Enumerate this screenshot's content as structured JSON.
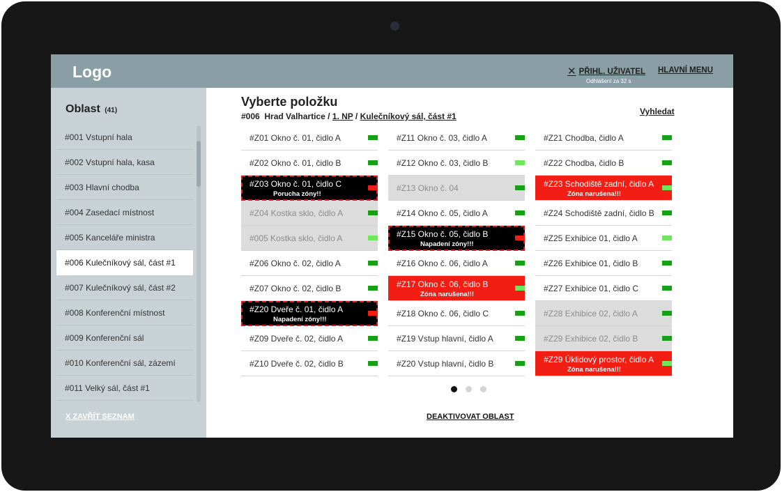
{
  "header": {
    "logo": "Logo",
    "logout_label": "PŘIHL. UŽIVATEL",
    "logout_timer": "Odhlášení za 32 s",
    "main_menu": "HLAVNÍ MENU"
  },
  "sidebar": {
    "title": "Oblast",
    "count": "(41)",
    "items": [
      {
        "label": "#001  Vstupní hala"
      },
      {
        "label": "#002  Vstupní hala, kasa"
      },
      {
        "label": "#003  Hlavní chodba"
      },
      {
        "label": "#004  Zasedací místnost"
      },
      {
        "label": "#005  Kanceláře ministra"
      },
      {
        "label": "#006  Kulečníkový sál, část #1"
      },
      {
        "label": "#007  Kulečníkový sál, část #2"
      },
      {
        "label": "#008  Konferenční místnost"
      },
      {
        "label": "#009  Konferenční sál"
      },
      {
        "label": "#010   Konferenční sál, zázemí"
      },
      {
        "label": "#011  Velký sál, část #1"
      }
    ],
    "active_index": 5,
    "close_label": "X ZAVŘÍT SEZNAM"
  },
  "main": {
    "title": "Vyberte položku",
    "breadcrumb": {
      "id": "#006",
      "building": "Hrad Valhartice",
      "sep1": "/",
      "floor": "1. NP",
      "sep2": "/",
      "room": "Kulečníkový sál, část #1"
    },
    "search_label": "Vyhledat",
    "columns": [
      [
        {
          "label": "#Z01  Okno č. 01, čidlo A",
          "state": "normal",
          "indicator": "green"
        },
        {
          "label": "#Z02  Okno č. 01, čidlo B",
          "state": "normal",
          "indicator": "green"
        },
        {
          "label": "#Z03  Okno č. 01, čidlo C",
          "state": "fault",
          "status": "Porucha zóny!!",
          "indicator": "red"
        },
        {
          "label": "#Z04  Kostka sklo, čidlo A",
          "state": "disabled",
          "indicator": "green"
        },
        {
          "label": "#005  Kostka sklo, čidlo A",
          "state": "disabled",
          "indicator": "light-green"
        },
        {
          "label": "#Z06  Okno č. 02, čidlo A",
          "state": "normal",
          "indicator": "green"
        },
        {
          "label": "#Z07  Okno č. 02, čidlo B",
          "state": "normal",
          "indicator": "green"
        },
        {
          "label": "#Z20  Dveře č. 01, čidlo A",
          "state": "fault",
          "status": "Napadení zóny!!!",
          "indicator": "red"
        },
        {
          "label": "#Z09  Dveře č. 02, čidlo A",
          "state": "normal",
          "indicator": "green"
        },
        {
          "label": "#Z10  Dveře č. 02, čidlo B",
          "state": "normal",
          "indicator": "green"
        }
      ],
      [
        {
          "label": "#Z11  Okno č. 03, čidlo A",
          "state": "normal",
          "indicator": "green"
        },
        {
          "label": "#Z12  Okno č. 03, čidlo B",
          "state": "normal",
          "indicator": "light-green"
        },
        {
          "label": "#Z13  Okno č. 04",
          "state": "disabled",
          "indicator": "green"
        },
        {
          "label": "#Z14  Okno č. 05, čidlo A",
          "state": "normal",
          "indicator": "green"
        },
        {
          "label": "#Z15  Okno č. 05, čidlo B",
          "state": "fault",
          "status": "Napadení zóny!!!",
          "indicator": "red"
        },
        {
          "label": "#Z16  Okno č. 06, čidlo A",
          "state": "normal",
          "indicator": "green"
        },
        {
          "label": "#Z17  Okno č. 06, čidlo B",
          "state": "alarm",
          "status": "Zóna narušena!!!",
          "indicator": "light-green"
        },
        {
          "label": "#Z18  Okno č. 06, čidlo C",
          "state": "normal",
          "indicator": "green"
        },
        {
          "label": "#Z19  Vstup hlavní, čidlo A",
          "state": "normal",
          "indicator": "green"
        },
        {
          "label": "#Z20  Vstup hlavní, čidlo B",
          "state": "normal",
          "indicator": "green"
        }
      ],
      [
        {
          "label": "#Z21  Chodba, čidlo A",
          "state": "normal",
          "indicator": "green"
        },
        {
          "label": "#Z22  Chodba, čidlo B",
          "state": "normal",
          "indicator": "green"
        },
        {
          "label": "#Z23  Schodiště zadní, čidlo A",
          "state": "alarm",
          "status": "Zóna narušena!!!",
          "indicator": "light-green"
        },
        {
          "label": "#Z24  Schodiště zadní, čidlo B",
          "state": "normal",
          "indicator": "green"
        },
        {
          "label": "#Z25  Exhibice 01, čidlo A",
          "state": "normal",
          "indicator": "light-green"
        },
        {
          "label": "#Z26  Exhibice 01, čidlo B",
          "state": "normal",
          "indicator": "green"
        },
        {
          "label": "#Z27  Exhibice 01, čidlo C",
          "state": "normal",
          "indicator": "green"
        },
        {
          "label": "#Z28  Exhibice 02, čidlo A",
          "state": "disabled",
          "indicator": "green"
        },
        {
          "label": "#Z29  Exhibice 02, čidlo B",
          "state": "disabled",
          "indicator": "green"
        },
        {
          "label": "#Z29  Úklidový prostor, čidlo A",
          "state": "alarm",
          "status": "Zóna narušena!!!",
          "indicator": "light-green"
        }
      ]
    ],
    "pagination": {
      "pages": 3,
      "current": 1
    },
    "deactivate_label": "DEAKTIVOVAT OBLAST"
  },
  "colors": {
    "header_bg": "#8a9ea6",
    "sidebar_bg": "#c8d2d6",
    "alarm": "#f21e14",
    "fault_bg": "#000000",
    "ok_indicator": "#16a016",
    "ok_indicator_light": "#6ee85a"
  }
}
